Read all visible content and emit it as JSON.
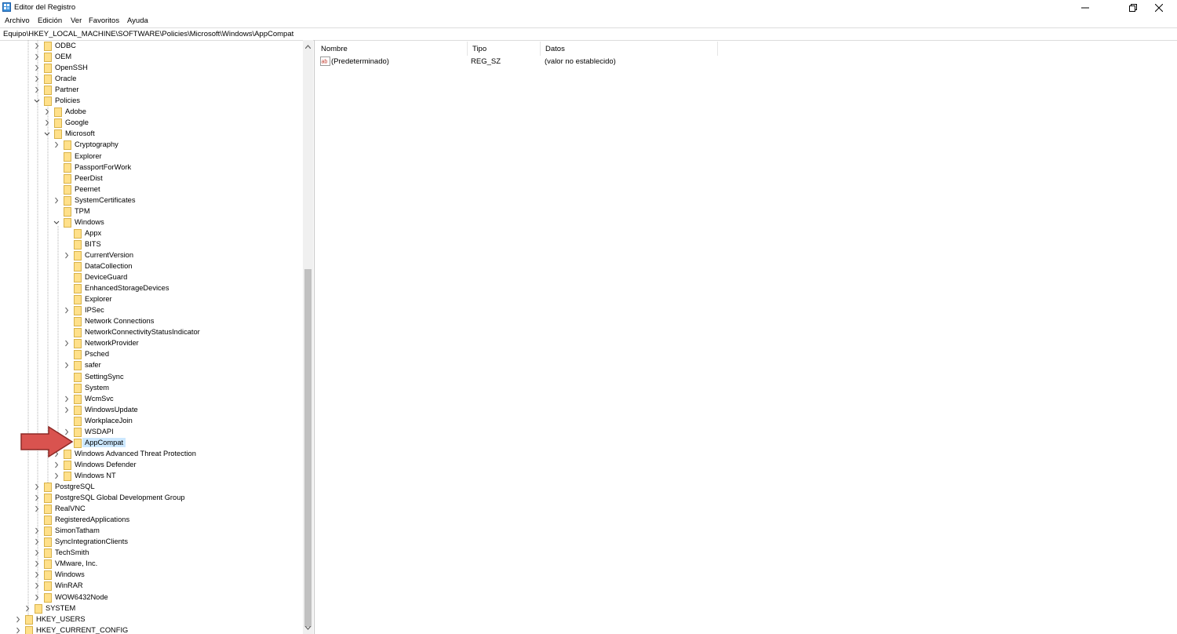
{
  "window": {
    "title": "Editor del Registro",
    "icon": "regedit-icon"
  },
  "menu": [
    "Archivo",
    "Edición",
    "Ver",
    "Favoritos",
    "Ayuda"
  ],
  "address": "Equipo\\HKEY_LOCAL_MACHINE\\SOFTWARE\\Policies\\Microsoft\\Windows\\AppCompat",
  "tree": [
    {
      "label": "ODBC",
      "level": 0,
      "exp": "collapsed"
    },
    {
      "label": "OEM",
      "level": 0,
      "exp": "collapsed"
    },
    {
      "label": "OpenSSH",
      "level": 0,
      "exp": "collapsed"
    },
    {
      "label": "Oracle",
      "level": 0,
      "exp": "collapsed"
    },
    {
      "label": "Partner",
      "level": 0,
      "exp": "collapsed"
    },
    {
      "label": "Policies",
      "level": 0,
      "exp": "expanded"
    },
    {
      "label": "Adobe",
      "level": 1,
      "exp": "collapsed"
    },
    {
      "label": "Google",
      "level": 1,
      "exp": "collapsed"
    },
    {
      "label": "Microsoft",
      "level": 1,
      "exp": "expanded"
    },
    {
      "label": "Cryptography",
      "level": 2,
      "exp": "collapsed"
    },
    {
      "label": "Explorer",
      "level": 2,
      "exp": "none"
    },
    {
      "label": "PassportForWork",
      "level": 2,
      "exp": "none"
    },
    {
      "label": "PeerDist",
      "level": 2,
      "exp": "none"
    },
    {
      "label": "Peernet",
      "level": 2,
      "exp": "none"
    },
    {
      "label": "SystemCertificates",
      "level": 2,
      "exp": "collapsed"
    },
    {
      "label": "TPM",
      "level": 2,
      "exp": "none"
    },
    {
      "label": "Windows",
      "level": 2,
      "exp": "expanded"
    },
    {
      "label": "Appx",
      "level": 3,
      "exp": "none"
    },
    {
      "label": "BITS",
      "level": 3,
      "exp": "none"
    },
    {
      "label": "CurrentVersion",
      "level": 3,
      "exp": "collapsed"
    },
    {
      "label": "DataCollection",
      "level": 3,
      "exp": "none"
    },
    {
      "label": "DeviceGuard",
      "level": 3,
      "exp": "none"
    },
    {
      "label": "EnhancedStorageDevices",
      "level": 3,
      "exp": "none"
    },
    {
      "label": "Explorer",
      "level": 3,
      "exp": "none"
    },
    {
      "label": "IPSec",
      "level": 3,
      "exp": "collapsed"
    },
    {
      "label": "Network Connections",
      "level": 3,
      "exp": "none"
    },
    {
      "label": "NetworkConnectivityStatusIndicator",
      "level": 3,
      "exp": "none"
    },
    {
      "label": "NetworkProvider",
      "level": 3,
      "exp": "collapsed"
    },
    {
      "label": "Psched",
      "level": 3,
      "exp": "none"
    },
    {
      "label": "safer",
      "level": 3,
      "exp": "collapsed"
    },
    {
      "label": "SettingSync",
      "level": 3,
      "exp": "none"
    },
    {
      "label": "System",
      "level": 3,
      "exp": "none"
    },
    {
      "label": "WcmSvc",
      "level": 3,
      "exp": "collapsed"
    },
    {
      "label": "WindowsUpdate",
      "level": 3,
      "exp": "collapsed"
    },
    {
      "label": "WorkplaceJoin",
      "level": 3,
      "exp": "none"
    },
    {
      "label": "WSDAPI",
      "level": 3,
      "exp": "collapsed"
    },
    {
      "label": "AppCompat",
      "level": 3,
      "exp": "none",
      "selected": true
    },
    {
      "label": "Windows Advanced Threat Protection",
      "level": 2,
      "exp": "collapsed"
    },
    {
      "label": "Windows Defender",
      "level": 2,
      "exp": "collapsed"
    },
    {
      "label": "Windows NT",
      "level": 2,
      "exp": "collapsed"
    },
    {
      "label": "PostgreSQL",
      "level": 0,
      "exp": "collapsed"
    },
    {
      "label": "PostgreSQL Global Development Group",
      "level": 0,
      "exp": "collapsed"
    },
    {
      "label": "RealVNC",
      "level": 0,
      "exp": "collapsed"
    },
    {
      "label": "RegisteredApplications",
      "level": 0,
      "exp": "none"
    },
    {
      "label": "SimonTatham",
      "level": 0,
      "exp": "collapsed"
    },
    {
      "label": "SyncIntegrationClients",
      "level": 0,
      "exp": "collapsed"
    },
    {
      "label": "TechSmith",
      "level": 0,
      "exp": "collapsed"
    },
    {
      "label": "VMware, Inc.",
      "level": 0,
      "exp": "collapsed"
    },
    {
      "label": "Windows",
      "level": 0,
      "exp": "collapsed"
    },
    {
      "label": "WinRAR",
      "level": 0,
      "exp": "collapsed"
    },
    {
      "label": "WOW6432Node",
      "level": 0,
      "exp": "collapsed"
    },
    {
      "label": "SYSTEM",
      "level": -1,
      "exp": "collapsed"
    },
    {
      "label": "HKEY_USERS",
      "level": -2,
      "exp": "collapsed"
    },
    {
      "label": "HKEY_CURRENT_CONFIG",
      "level": -2,
      "exp": "collapsed"
    }
  ],
  "columns": [
    "Nombre",
    "Tipo",
    "Datos"
  ],
  "values": [
    {
      "name": "(Predeterminado)",
      "type": "REG_SZ",
      "data": "(valor no establecido)",
      "icon": "string-value-icon"
    }
  ],
  "colors": {
    "selection": "#cce8ff",
    "annotation_arrow": "#d9534f",
    "folder": "#ffe08a"
  }
}
